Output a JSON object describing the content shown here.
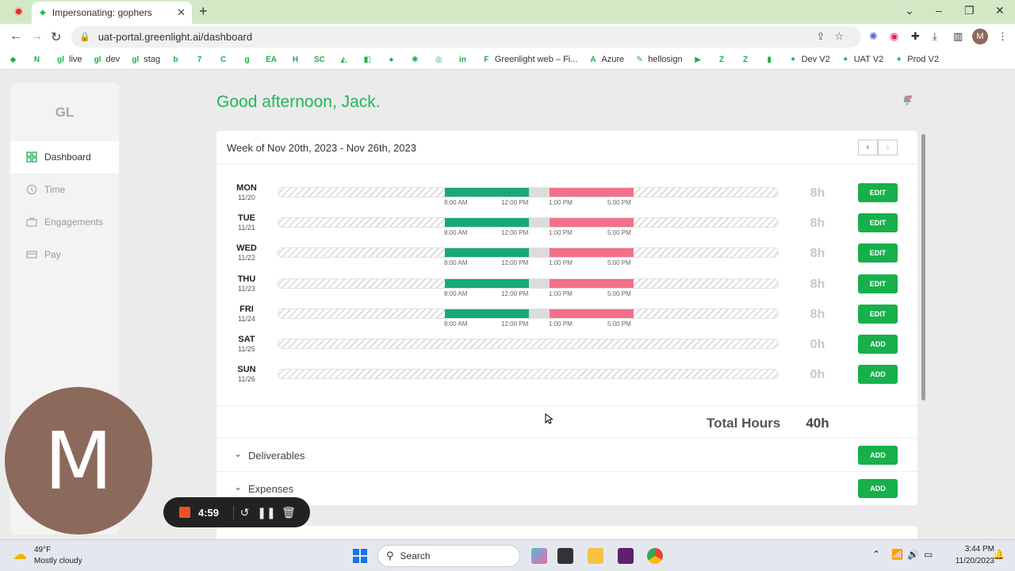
{
  "browser": {
    "tab_title": "Impersonating: gophers",
    "tab_close": "✕",
    "new_tab": "+",
    "url": "uat-portal.greenlight.ai/dashboard",
    "window_controls": [
      "⌄",
      "–",
      "❐",
      "✕"
    ],
    "profile_initial": "M"
  },
  "bookmarks": [
    {
      "icon": "◆",
      "label": ""
    },
    {
      "icon": "N",
      "label": ""
    },
    {
      "icon": "gl",
      "label": "live"
    },
    {
      "icon": "gl",
      "label": "dev"
    },
    {
      "icon": "gl",
      "label": "stag"
    },
    {
      "icon": "b",
      "label": ""
    },
    {
      "icon": "7",
      "label": ""
    },
    {
      "icon": "C",
      "label": ""
    },
    {
      "icon": "g",
      "label": ""
    },
    {
      "icon": "EA",
      "label": ""
    },
    {
      "icon": "H",
      "label": ""
    },
    {
      "icon": "SC",
      "label": ""
    },
    {
      "icon": "◭",
      "label": ""
    },
    {
      "icon": "◧",
      "label": ""
    },
    {
      "icon": "●",
      "label": ""
    },
    {
      "icon": "✱",
      "label": ""
    },
    {
      "icon": "◎",
      "label": ""
    },
    {
      "icon": "in",
      "label": ""
    },
    {
      "icon": "F",
      "label": "Greenlight web – Fi..."
    },
    {
      "icon": "A",
      "label": "Azure"
    },
    {
      "icon": "✎",
      "label": "hellosign"
    },
    {
      "icon": "▶",
      "label": ""
    },
    {
      "icon": "Z",
      "label": ""
    },
    {
      "icon": "Z",
      "label": ""
    },
    {
      "icon": "▮",
      "label": ""
    },
    {
      "icon": "✦",
      "label": "Dev V2"
    },
    {
      "icon": "✦",
      "label": "UAT V2"
    },
    {
      "icon": "✦",
      "label": "Prod V2"
    }
  ],
  "sidebar": {
    "logo": "GL",
    "items": [
      {
        "label": "Dashboard",
        "active": true
      },
      {
        "label": "Time",
        "active": false
      },
      {
        "label": "Engagements",
        "active": false
      },
      {
        "label": "Pay",
        "active": false
      }
    ]
  },
  "greeting": "Good afternoon, Jack.",
  "timesheet": {
    "week_label": "Week of Nov 20th, 2023 - Nov 26th, 2023",
    "prev": "‹",
    "next": "›",
    "days": [
      {
        "name": "MON",
        "date": "11/20",
        "hours": "8h",
        "action": "EDIT",
        "has_time": true
      },
      {
        "name": "TUE",
        "date": "11/21",
        "hours": "8h",
        "action": "EDIT",
        "has_time": true
      },
      {
        "name": "WED",
        "date": "11/22",
        "hours": "8h",
        "action": "EDIT",
        "has_time": true
      },
      {
        "name": "THU",
        "date": "11/23",
        "hours": "8h",
        "action": "EDIT",
        "has_time": true
      },
      {
        "name": "FRI",
        "date": "11/24",
        "hours": "8h",
        "action": "EDIT",
        "has_time": true
      },
      {
        "name": "SAT",
        "date": "11/25",
        "hours": "0h",
        "action": "ADD",
        "has_time": false
      },
      {
        "name": "SUN",
        "date": "11/26",
        "hours": "0h",
        "action": "ADD",
        "has_time": false
      }
    ],
    "time_labels": [
      "8:00 AM",
      "12:00 PM",
      "1:00 PM",
      "5:00 PM"
    ],
    "colors": {
      "morning": "#17a97c",
      "lunch": "#dcdcdc",
      "afternoon": "#f2708a"
    },
    "total_label": "Total Hours",
    "total_value": "40h"
  },
  "sections": [
    {
      "label": "Deliverables",
      "action": "ADD"
    },
    {
      "label": "Expenses",
      "action": "ADD"
    }
  ],
  "recorder": {
    "avatar_initial": "M",
    "timer": "4:59"
  },
  "taskbar": {
    "temperature": "49°F",
    "weather": "Mostly cloudy",
    "search": "Search",
    "time": "3:44 PM",
    "date": "11/20/2023"
  }
}
